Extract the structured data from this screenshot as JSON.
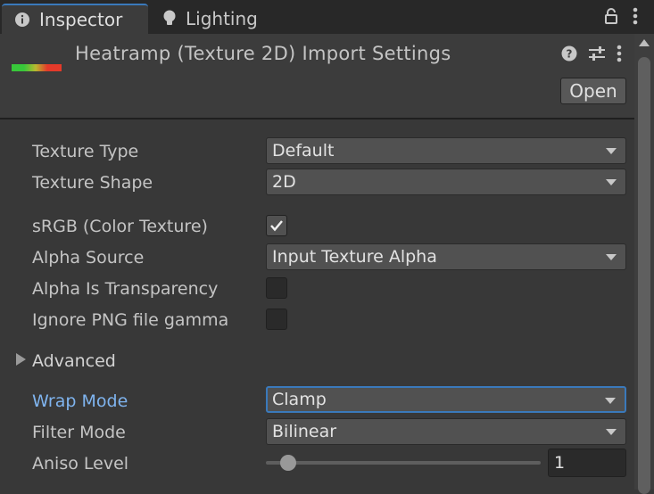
{
  "tabs": {
    "inspector": {
      "label": "Inspector",
      "icon": "info-icon"
    },
    "lighting": {
      "label": "Lighting",
      "icon": "lightbulb-icon"
    }
  },
  "header": {
    "title": "Heatramp (Texture 2D) Import Settings",
    "open_label": "Open"
  },
  "fields": {
    "texture_type": {
      "label": "Texture Type",
      "value": "Default"
    },
    "texture_shape": {
      "label": "Texture Shape",
      "value": "2D"
    },
    "srgb": {
      "label": "sRGB (Color Texture)",
      "checked": true
    },
    "alpha_source": {
      "label": "Alpha Source",
      "value": "Input Texture Alpha"
    },
    "alpha_is_transparency": {
      "label": "Alpha Is Transparency",
      "checked": false
    },
    "ignore_png_gamma": {
      "label": "Ignore PNG file gamma",
      "checked": false
    },
    "advanced": {
      "label": "Advanced",
      "expanded": false
    },
    "wrap_mode": {
      "label": "Wrap Mode",
      "value": "Clamp"
    },
    "filter_mode": {
      "label": "Filter Mode",
      "value": "Bilinear"
    },
    "aniso_level": {
      "label": "Aniso Level",
      "value": "1"
    }
  },
  "colors": {
    "accent": "#3a79bb",
    "highlight_label": "#7fb4ef",
    "ramp_green": "#38c83a",
    "ramp_red": "#e43a2a"
  }
}
